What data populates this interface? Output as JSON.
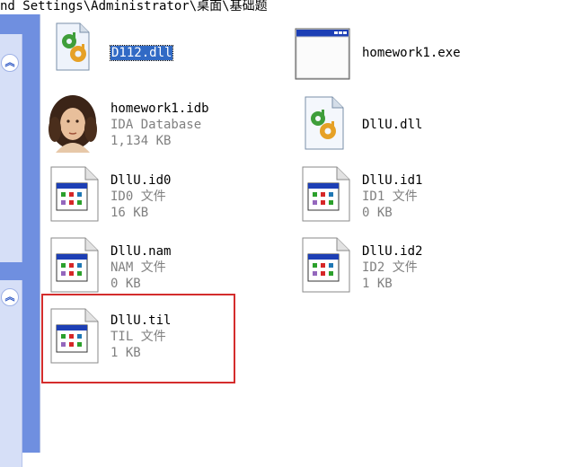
{
  "address_bar": {
    "path": "nd Settings\\Administrator\\桌面\\基础题"
  },
  "task_panels": {
    "collapse_glyph": "︽"
  },
  "files": [
    {
      "name": "D112.dll",
      "line2": "",
      "line3": "",
      "icon": "dll-icon",
      "selected": true
    },
    {
      "name": "homework1.exe",
      "line2": "",
      "line3": "",
      "icon": "exe-window-icon",
      "selected": false
    },
    {
      "name": "homework1.idb",
      "line2": "IDA Database",
      "line3": "1,134 KB",
      "icon": "ida-portrait-icon",
      "selected": false
    },
    {
      "name": "DllU.dll",
      "line2": "",
      "line3": "",
      "icon": "dll-icon",
      "selected": false
    },
    {
      "name": "DllU.id0",
      "line2": "ID0 文件",
      "line3": "16 KB",
      "icon": "generic-file-icon",
      "selected": false
    },
    {
      "name": "DllU.id1",
      "line2": "ID1 文件",
      "line3": "0 KB",
      "icon": "generic-file-icon",
      "selected": false
    },
    {
      "name": "DllU.nam",
      "line2": "NAM 文件",
      "line3": "0 KB",
      "icon": "generic-file-icon",
      "selected": false
    },
    {
      "name": "DllU.id2",
      "line2": "ID2 文件",
      "line3": "1 KB",
      "icon": "generic-file-icon",
      "selected": false
    },
    {
      "name": "DllU.til",
      "line2": "TIL 文件",
      "line3": "1 KB",
      "icon": "generic-file-icon",
      "selected": false
    }
  ],
  "colors": {
    "selection": "#316ac5",
    "sidebar": "#6f8fe0",
    "annotation": "#d42d2d",
    "subtext": "#808080"
  }
}
